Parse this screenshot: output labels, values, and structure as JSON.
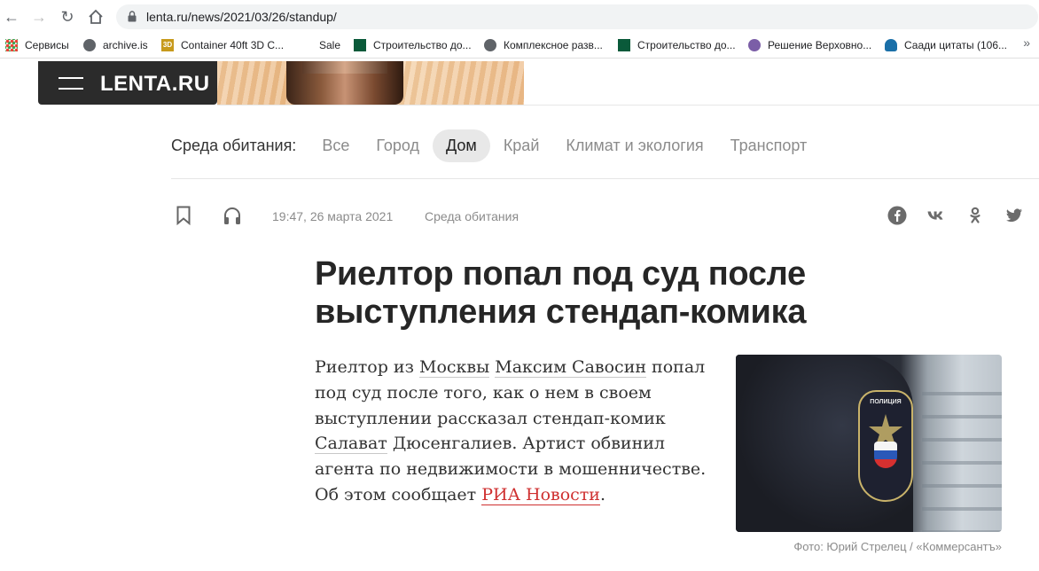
{
  "browser": {
    "url": "lenta.ru/news/2021/03/26/standup/",
    "bookmarks": [
      {
        "label": "Сервисы",
        "icon": "apps-grid-icon"
      },
      {
        "label": "archive.is",
        "icon": "globe-icon"
      },
      {
        "label": "Container 40ft 3D C...",
        "icon": "3d-icon"
      },
      {
        "label": "Sale",
        "icon": ""
      },
      {
        "label": "Строительство до...",
        "icon": "page-icon"
      },
      {
        "label": "Комплексное разв...",
        "icon": "globe-icon"
      },
      {
        "label": "Строительство до...",
        "icon": "page-icon"
      },
      {
        "label": "Решение Верховно...",
        "icon": "avatar-icon"
      },
      {
        "label": "Саади цитаты (106...",
        "icon": "tree-icon"
      }
    ],
    "more": "»"
  },
  "header": {
    "logo": "LENTA.RU"
  },
  "rubrics": {
    "title": "Среда обитания:",
    "items": [
      {
        "label": "Все",
        "active": false
      },
      {
        "label": "Город",
        "active": false
      },
      {
        "label": "Дом",
        "active": true
      },
      {
        "label": "Край",
        "active": false
      },
      {
        "label": "Климат и экология",
        "active": false
      },
      {
        "label": "Транспорт",
        "active": false
      }
    ]
  },
  "article": {
    "datetime": "19:47, 26 марта 2021",
    "rubric": "Среда обитания",
    "title": "Риелтор попал под суд после выступления стендап-комика",
    "lead": {
      "t1": "Риелтор из ",
      "link_moscow": "Москвы",
      "t2": " ",
      "link_person": "Максим Савосин",
      "t3": " попал под суд после того, как о нем в своем выступлении рассказал стендап-комик ",
      "link_salavat": "Салават",
      "t4": " Дюсенгалиев. Артист обвинил агента по недвижимости в мошенничестве. Об этом сообщает ",
      "link_ria": "РИА Новости",
      "t5": "."
    },
    "photo_caption": "Фото: Юрий Стрелец / «Коммерсантъ»",
    "patch_text": "ПОЛИЦИЯ"
  },
  "share": [
    "facebook-icon",
    "vk-icon",
    "odnoklassniki-icon",
    "twitter-icon"
  ],
  "colors": {
    "accent_red": "#cf3030",
    "header_bg": "#2b2b2b"
  }
}
